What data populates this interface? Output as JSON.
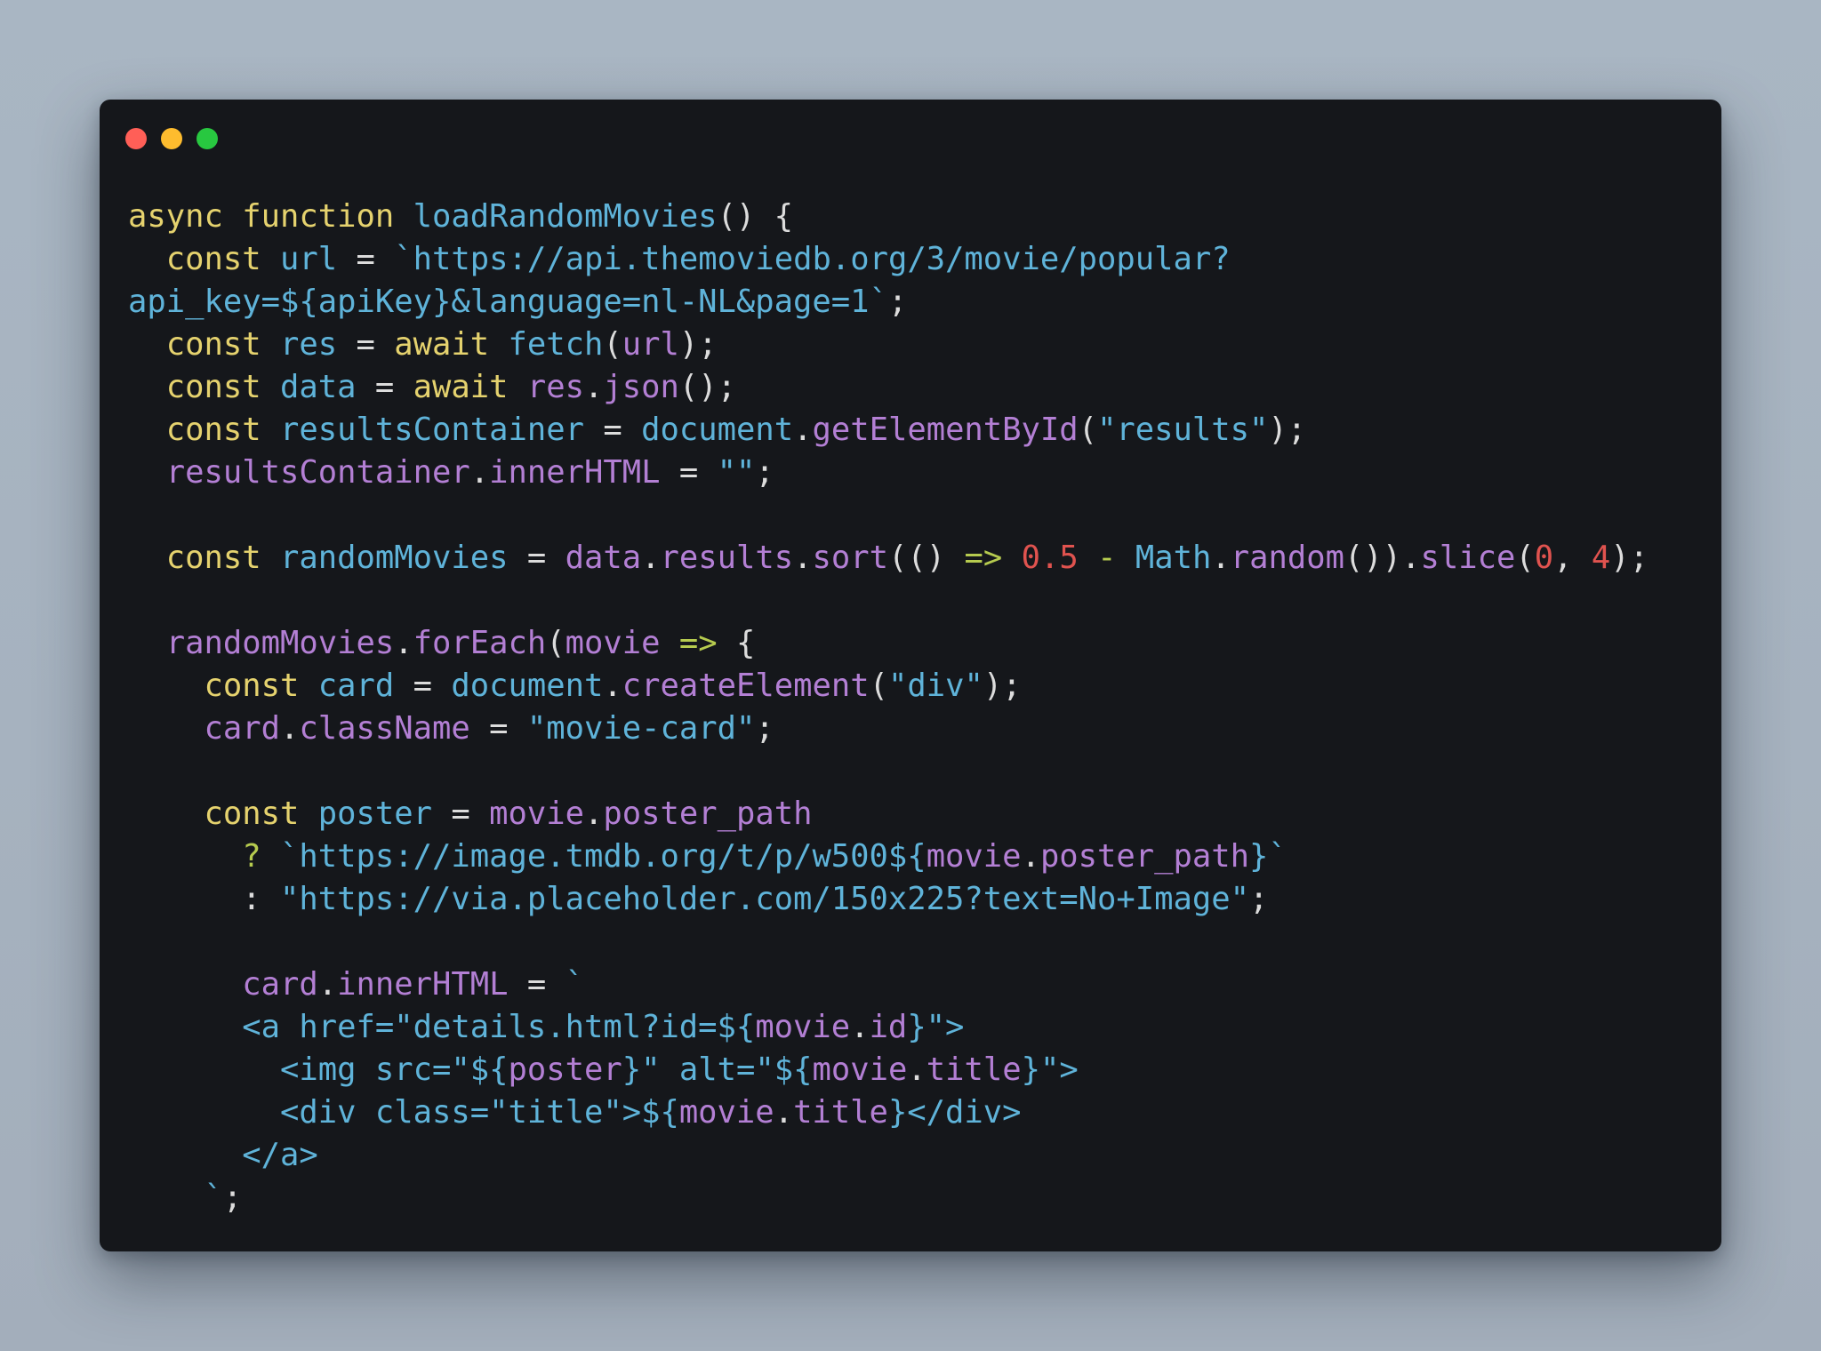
{
  "window": {
    "buttons": [
      {
        "name": "close",
        "color": "#ff5f57"
      },
      {
        "name": "minimize",
        "color": "#febc2e"
      },
      {
        "name": "maximize",
        "color": "#28c840"
      }
    ]
  },
  "code": {
    "language": "javascript",
    "lines": [
      [
        [
          "k",
          "async function "
        ],
        [
          "v",
          "loadRandomMovies"
        ],
        [
          "w",
          "() {"
        ]
      ],
      [
        [
          "w",
          "  "
        ],
        [
          "k",
          "const "
        ],
        [
          "v",
          "url "
        ],
        [
          "w",
          "= "
        ],
        [
          "s",
          "`https://api.themoviedb.org/3/movie/popular?"
        ]
      ],
      [
        [
          "s",
          "api_key=${apiKey}&language=nl-NL&page=1`"
        ],
        [
          "w",
          ";"
        ]
      ],
      [
        [
          "w",
          "  "
        ],
        [
          "k",
          "const "
        ],
        [
          "v",
          "res "
        ],
        [
          "w",
          "= "
        ],
        [
          "k",
          "await "
        ],
        [
          "v",
          "fetch"
        ],
        [
          "w",
          "("
        ],
        [
          "p",
          "url"
        ],
        [
          "w",
          ");"
        ]
      ],
      [
        [
          "w",
          "  "
        ],
        [
          "k",
          "const "
        ],
        [
          "v",
          "data "
        ],
        [
          "w",
          "= "
        ],
        [
          "k",
          "await "
        ],
        [
          "p",
          "res"
        ],
        [
          "w",
          "."
        ],
        [
          "p",
          "json"
        ],
        [
          "w",
          "();"
        ]
      ],
      [
        [
          "w",
          "  "
        ],
        [
          "k",
          "const "
        ],
        [
          "v",
          "resultsContainer "
        ],
        [
          "w",
          "= "
        ],
        [
          "v",
          "document"
        ],
        [
          "w",
          "."
        ],
        [
          "p",
          "getElementById"
        ],
        [
          "w",
          "("
        ],
        [
          "s",
          "\"results\""
        ],
        [
          "w",
          ");"
        ]
      ],
      [
        [
          "w",
          "  "
        ],
        [
          "p",
          "resultsContainer"
        ],
        [
          "w",
          "."
        ],
        [
          "p",
          "innerHTML "
        ],
        [
          "w",
          "= "
        ],
        [
          "s",
          "\"\""
        ],
        [
          "w",
          ";"
        ]
      ],
      [],
      [
        [
          "w",
          "  "
        ],
        [
          "k",
          "const "
        ],
        [
          "v",
          "randomMovies "
        ],
        [
          "w",
          "= "
        ],
        [
          "p",
          "data"
        ],
        [
          "w",
          "."
        ],
        [
          "p",
          "results"
        ],
        [
          "w",
          "."
        ],
        [
          "p",
          "sort"
        ],
        [
          "w",
          "(() "
        ],
        [
          "o",
          "=> "
        ],
        [
          "n",
          "0.5 "
        ],
        [
          "o",
          "- "
        ],
        [
          "v",
          "Math"
        ],
        [
          "w",
          "."
        ],
        [
          "p",
          "random"
        ],
        [
          "w",
          "())."
        ],
        [
          "p",
          "slice"
        ],
        [
          "w",
          "("
        ],
        [
          "n",
          "0"
        ],
        [
          "w",
          ", "
        ],
        [
          "n",
          "4"
        ],
        [
          "w",
          ");"
        ]
      ],
      [],
      [
        [
          "w",
          "  "
        ],
        [
          "p",
          "randomMovies"
        ],
        [
          "w",
          "."
        ],
        [
          "p",
          "forEach"
        ],
        [
          "w",
          "("
        ],
        [
          "p",
          "movie "
        ],
        [
          "o",
          "=> "
        ],
        [
          "w",
          "{"
        ]
      ],
      [
        [
          "w",
          "    "
        ],
        [
          "k",
          "const "
        ],
        [
          "v",
          "card "
        ],
        [
          "w",
          "= "
        ],
        [
          "v",
          "document"
        ],
        [
          "w",
          "."
        ],
        [
          "p",
          "createElement"
        ],
        [
          "w",
          "("
        ],
        [
          "s",
          "\"div\""
        ],
        [
          "w",
          ");"
        ]
      ],
      [
        [
          "w",
          "    "
        ],
        [
          "p",
          "card"
        ],
        [
          "w",
          "."
        ],
        [
          "p",
          "className "
        ],
        [
          "w",
          "= "
        ],
        [
          "s",
          "\"movie-card\""
        ],
        [
          "w",
          ";"
        ]
      ],
      [],
      [
        [
          "w",
          "    "
        ],
        [
          "k",
          "const "
        ],
        [
          "v",
          "poster "
        ],
        [
          "w",
          "= "
        ],
        [
          "p",
          "movie"
        ],
        [
          "w",
          "."
        ],
        [
          "p",
          "poster_path"
        ]
      ],
      [
        [
          "w",
          "      "
        ],
        [
          "o",
          "? "
        ],
        [
          "s",
          "`https://image.tmdb.org/t/p/w500${"
        ],
        [
          "p",
          "movie"
        ],
        [
          "w",
          "."
        ],
        [
          "p",
          "poster_path"
        ],
        [
          "s",
          "}`"
        ]
      ],
      [
        [
          "w",
          "      : "
        ],
        [
          "s",
          "\"https://via.placeholder.com/150x225?text=No+Image\""
        ],
        [
          "w",
          ";"
        ]
      ],
      [],
      [
        [
          "w",
          "      "
        ],
        [
          "p",
          "card"
        ],
        [
          "w",
          "."
        ],
        [
          "p",
          "innerHTML "
        ],
        [
          "w",
          "= "
        ],
        [
          "s",
          "`"
        ]
      ],
      [
        [
          "s",
          "      <a href=\"details.html?id=${"
        ],
        [
          "p",
          "movie"
        ],
        [
          "w",
          "."
        ],
        [
          "p",
          "id"
        ],
        [
          "s",
          "}\">"
        ]
      ],
      [
        [
          "s",
          "        <img src=\"${"
        ],
        [
          "p",
          "poster"
        ],
        [
          "s",
          "}\" alt=\"${"
        ],
        [
          "p",
          "movie"
        ],
        [
          "w",
          "."
        ],
        [
          "p",
          "title"
        ],
        [
          "s",
          "}\">"
        ]
      ],
      [
        [
          "s",
          "        <div class=\"title\">${"
        ],
        [
          "p",
          "movie"
        ],
        [
          "w",
          "."
        ],
        [
          "p",
          "title"
        ],
        [
          "s",
          "}</div>"
        ]
      ],
      [
        [
          "s",
          "      </a>"
        ]
      ],
      [
        [
          "s",
          "    `"
        ],
        [
          "w",
          ";"
        ]
      ]
    ]
  }
}
